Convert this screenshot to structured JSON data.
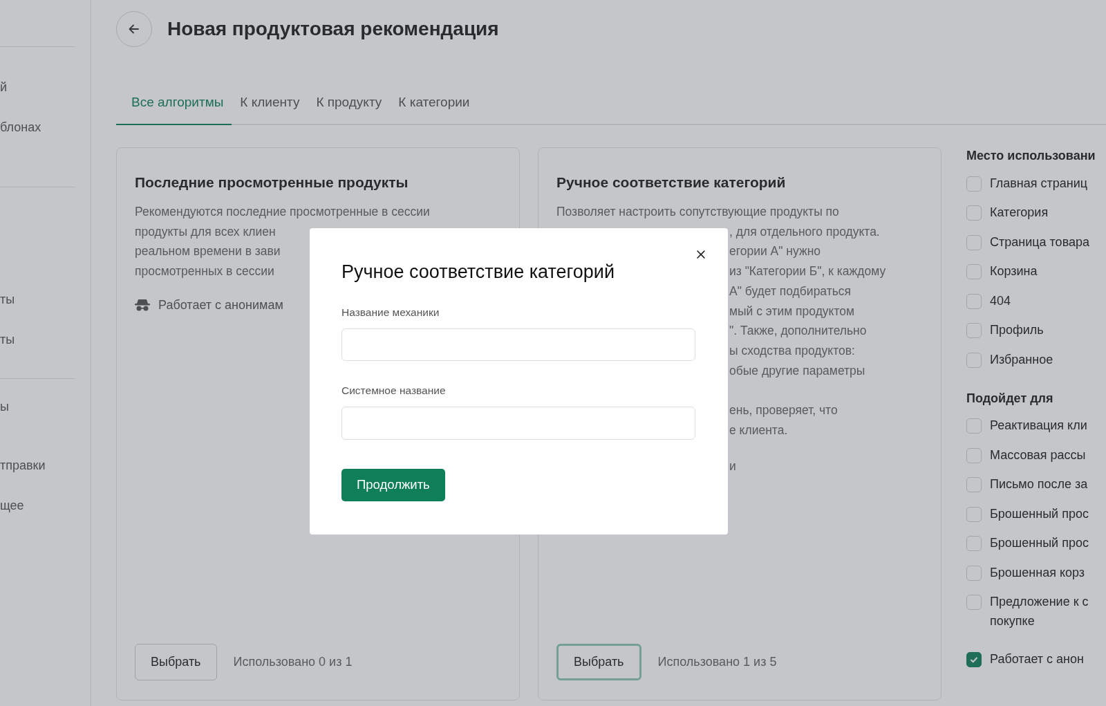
{
  "sidebar": {
    "groups": [
      {
        "items": [
          "й",
          "блонах"
        ]
      },
      {
        "items": [
          "ты",
          "ты"
        ]
      },
      {
        "items": [
          "ы",
          "тправки",
          "щее"
        ]
      }
    ]
  },
  "header": {
    "title": "Новая продуктовая рекомендация"
  },
  "tabs": [
    {
      "label": "Все алгоритмы",
      "selected": true
    },
    {
      "label": "К клиенту",
      "selected": false
    },
    {
      "label": "К продукту",
      "selected": false
    },
    {
      "label": "К категории",
      "selected": false
    }
  ],
  "cards": [
    {
      "title": "Последние просмотренные продукты",
      "lines": [
        "Рекомендуются последние просмотренные в сессии",
        "продукты для всех клиен",
        "реальном времени в зави",
        "просмотренных в сессии"
      ],
      "anon": "Работает с анонимам",
      "button": {
        "label": "Выбрать",
        "focused": false
      },
      "usage": "Использовано 0 из 1"
    },
    {
      "title": "Ручное соответствие категорий",
      "lines": [
        "Позволяет настроить сопутствующие продукты по"
      ],
      "fragments_beside_dialog": [
        [
          ", для отдельного продукта.",
          "егории А\" нужно",
          "из \"Категории Б\", к каждому",
          "А\" будет подбираться",
          "мый с этим продуктом",
          "\". Также, дополнительно",
          "ы сходства продуктов:",
          "обые другие параметры"
        ],
        [
          "ень, проверяет, что",
          "е клиента."
        ],
        [
          "и"
        ]
      ],
      "button": {
        "label": "Выбрать",
        "focused": true
      },
      "usage": "Использовано 1 из 5"
    }
  ],
  "filters": [
    {
      "title": "Место использовани",
      "options": [
        {
          "label": "Главная страниц",
          "checked": false
        },
        {
          "label": "Категория",
          "checked": false
        },
        {
          "label": "Страница товара",
          "checked": false
        },
        {
          "label": "Корзина",
          "checked": false
        },
        {
          "label": "404",
          "checked": false
        },
        {
          "label": "Профиль",
          "checked": false
        },
        {
          "label": "Избранное",
          "checked": false
        }
      ]
    },
    {
      "title": "Подойдет для",
      "options": [
        {
          "label": "Реактивация кли",
          "checked": false
        },
        {
          "label": "Массовая рассы",
          "checked": false
        },
        {
          "label": "Письмо после за",
          "checked": false
        },
        {
          "label": "Брошенный прос",
          "checked": false
        },
        {
          "label": "Брошенный прос",
          "checked": false
        },
        {
          "label": "Брошенная корз",
          "checked": false
        },
        {
          "label": "Предложение к с покупке",
          "checked": false
        }
      ]
    },
    {
      "options": [
        {
          "label": "Работает с анон",
          "checked": true
        }
      ]
    }
  ],
  "modal": {
    "title": "Ручное соответствие категорий",
    "fields": [
      {
        "label": "Название механики"
      },
      {
        "label": "Системное название"
      }
    ],
    "submit": "Продолжить"
  }
}
